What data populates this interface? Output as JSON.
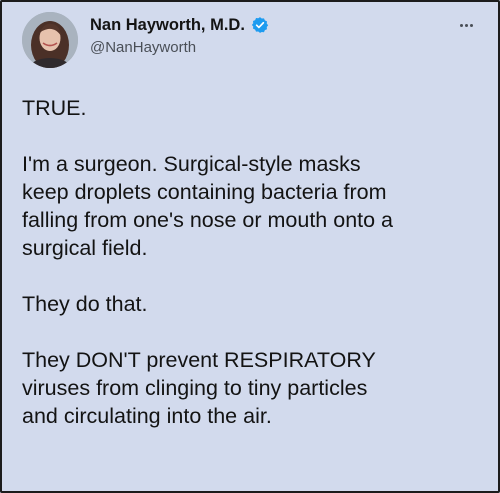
{
  "author": {
    "name": "Nan Hayworth, M.D.",
    "handle": "@NanHayworth"
  },
  "icons": {
    "avatar": "profile-photo",
    "verified": "verified-badge-icon",
    "more": "more-options-icon"
  },
  "colors": {
    "background": "#d2daed",
    "text": "#131313",
    "handle": "#4a4f57",
    "verified": "#1d9bf0"
  },
  "tweet": {
    "paragraphs": [
      "TRUE.",
      "I'm a surgeon. Surgical-style masks\nkeep droplets containing bacteria from\nfalling from one's nose or mouth onto a\nsurgical field.",
      "They do that.",
      "They DON'T prevent RESPIRATORY\nviruses from clinging to tiny particles\nand circulating into the air."
    ]
  }
}
